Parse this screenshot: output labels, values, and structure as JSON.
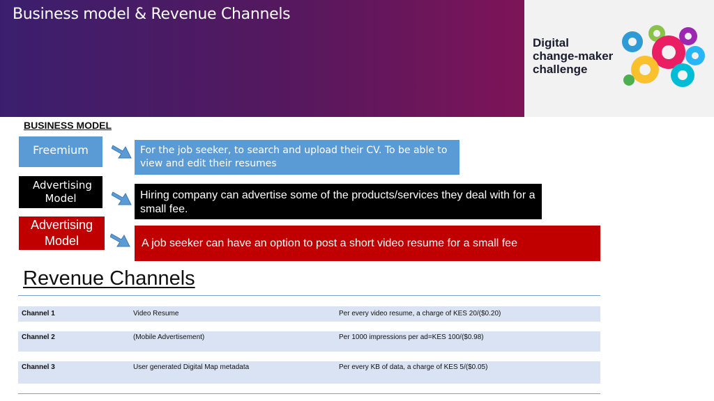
{
  "header": {
    "title": "Business model & Revenue Channels"
  },
  "logo": {
    "line1": "Digital",
    "line2": "change-maker",
    "line3": "challenge"
  },
  "business_model": {
    "heading": "BUSINESS MODEL",
    "items": [
      {
        "label": "Freemium",
        "description": "For the job seeker, to search and upload their CV. To be able to view and edit their resumes",
        "color": "#5b9bd5"
      },
      {
        "label": "Advertising Model",
        "description": "Hiring company can advertise some of the products/services they deal with for a small fee.",
        "color": "#000000"
      },
      {
        "label": "Advertising Model",
        "description": "A job seeker  can have an option to post a short video resume for a small fee",
        "color": "#c00000"
      }
    ]
  },
  "revenue_channels": {
    "heading": "Revenue Channels",
    "rows": [
      {
        "channel": "Channel 1",
        "item": "Video Resume",
        "charge": "Per every video resume, a charge of KES 20/($0.20)"
      },
      {
        "channel": "Channel 2",
        "item": "(Mobile Advertisement)",
        "charge": "Per 1000 impressions per ad=KES 100/($0.98)"
      },
      {
        "channel": "Channel  3",
        "item": "User generated Digital Map metadata",
        "charge": "Per every KB of data, a charge of KES 5/($0.05)"
      }
    ]
  },
  "colors": {
    "banner_start": "#3b1f6e",
    "banner_end": "#7e1458",
    "table_row": "#dae3f3",
    "arrow": "#5b9bd5"
  }
}
